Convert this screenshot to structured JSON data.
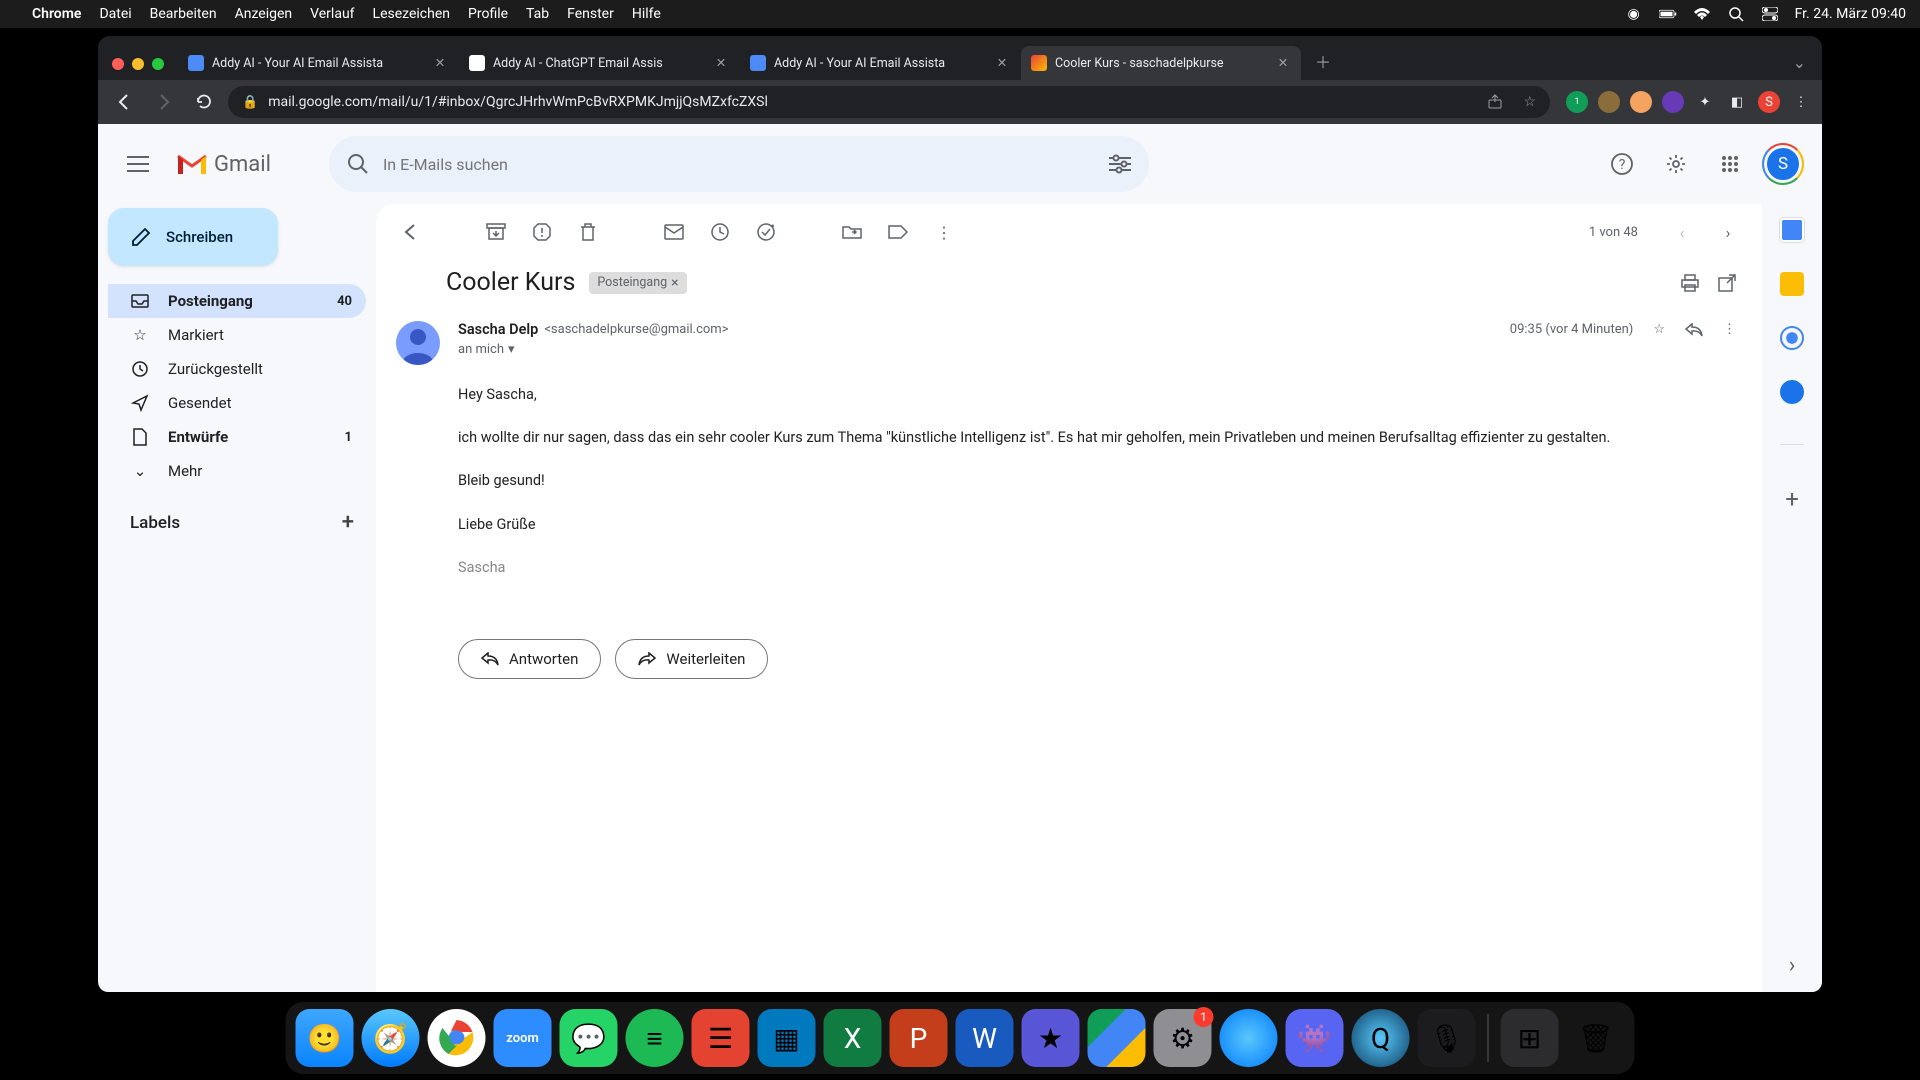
{
  "menubar": {
    "app": "Chrome",
    "items": [
      "Datei",
      "Bearbeiten",
      "Anzeigen",
      "Verlauf",
      "Lesezeichen",
      "Profile",
      "Tab",
      "Fenster",
      "Hilfe"
    ],
    "datetime": "Fr. 24. März 09:40"
  },
  "tabs": [
    {
      "title": "Addy AI - Your AI Email Assista",
      "favicon": "#4c8bf5"
    },
    {
      "title": "Addy AI - ChatGPT Email Assis",
      "favicon": "#ffffff"
    },
    {
      "title": "Addy AI - Your AI Email Assista",
      "favicon": "#4c8bf5"
    },
    {
      "title": "Cooler Kurs - saschadelpkurse",
      "favicon": "#ea4335",
      "active": true
    }
  ],
  "url": "mail.google.com/mail/u/1/#inbox/QgrcJHrhvWmPcBvRXPMKJmjjQsMZxfcZXSl",
  "gmail": {
    "logo_text": "Gmail",
    "search_placeholder": "In E-Mails suchen",
    "avatar_initial": "S"
  },
  "compose": "Schreiben",
  "nav": [
    {
      "icon": "inbox",
      "label": "Posteingang",
      "count": "40",
      "active": true,
      "bold": true
    },
    {
      "icon": "star",
      "label": "Markiert"
    },
    {
      "icon": "clock",
      "label": "Zurückgestellt"
    },
    {
      "icon": "send",
      "label": "Gesendet"
    },
    {
      "icon": "draft",
      "label": "Entwürfe",
      "count": "1",
      "bold": true
    },
    {
      "icon": "more",
      "label": "Mehr"
    }
  ],
  "labels_header": "Labels",
  "toolbar_count": "1 von 48",
  "email": {
    "subject": "Cooler Kurs",
    "chip": "Posteingang",
    "sender_name": "Sascha Delp",
    "sender_email": "<saschadelpkurse@gmail.com>",
    "timestamp": "09:35 (vor 4 Minuten)",
    "recipient": "an mich",
    "body": {
      "greeting": "Hey Sascha,",
      "p1": "ich wollte dir nur sagen, dass das ein sehr cooler Kurs zum Thema \"künstliche Intelligenz ist\". Es hat mir geholfen, mein Privatleben und meinen Berufsalltag effizienter zu gestalten.",
      "p2": "Bleib gesund!",
      "closing": "Liebe Grüße",
      "signature": "Sascha"
    },
    "reply": "Antworten",
    "forward": "Weiterleiten"
  },
  "dock_badge": "1"
}
